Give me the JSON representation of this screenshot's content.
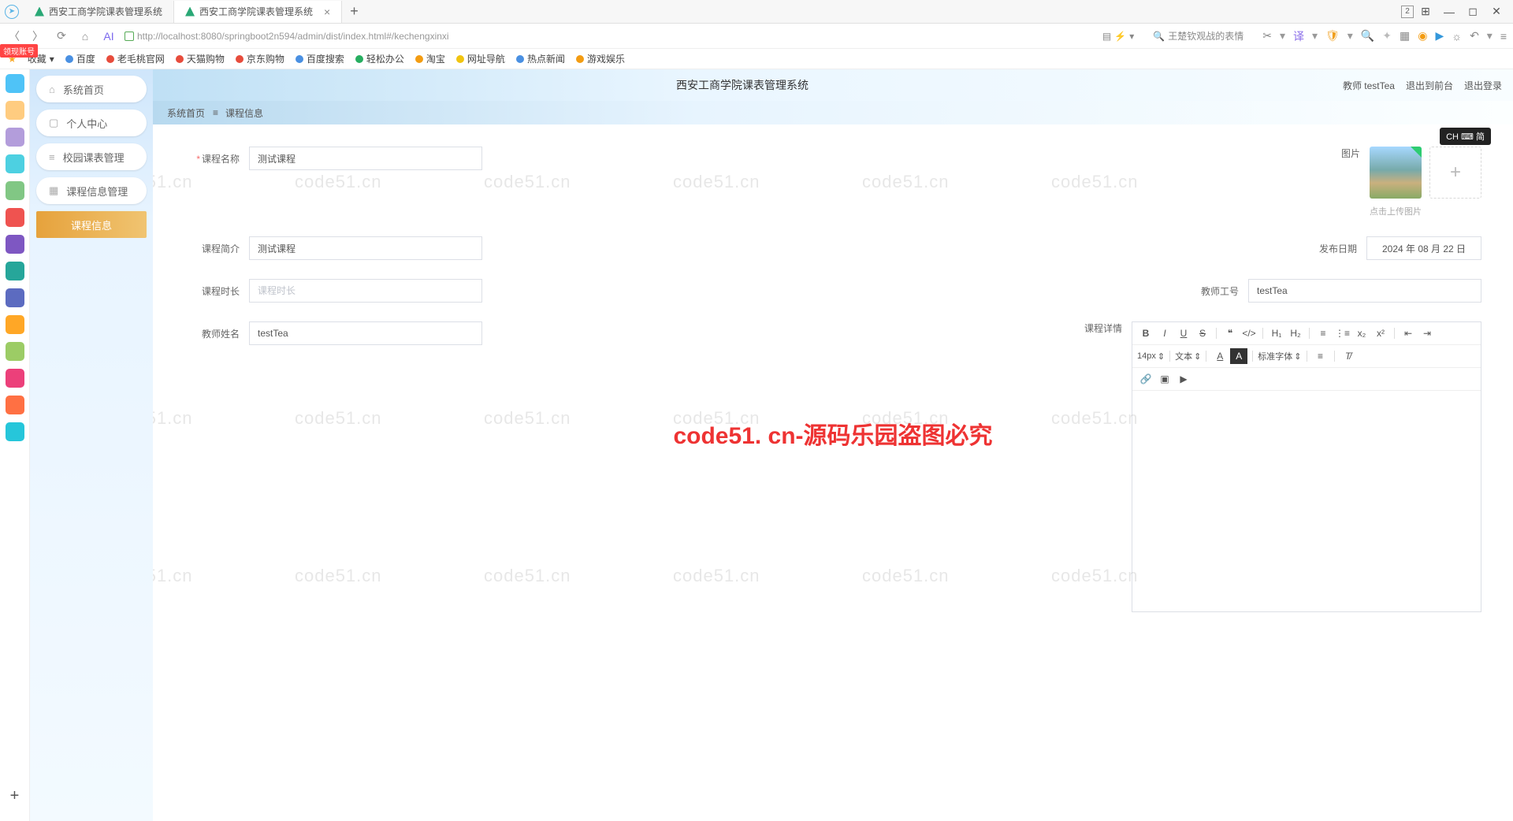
{
  "browser": {
    "tabs": [
      {
        "title": "西安工商学院课表管理系统",
        "active": false
      },
      {
        "title": "西安工商学院课表管理系统",
        "active": true
      }
    ],
    "tab_count_badge": "2",
    "url": "http://localhost:8080/springboot2n594/admin/dist/index.html#/kechengxinxi",
    "search_placeholder": "王楚钦观战的表情",
    "bookmarks": [
      "收藏",
      "百度",
      "老毛桃官网",
      "天猫购物",
      "京东购物",
      "百度搜索",
      "轻松办公",
      "淘宝",
      "网址导航",
      "热点新闻",
      "游戏娱乐"
    ],
    "bm_colors": [
      "#f9a825",
      "#4a90e2",
      "#e74c3c",
      "#e74c3c",
      "#e74c3c",
      "#4a90e2",
      "#27ae60",
      "#f39c12",
      "#f1c40f",
      "#4a90e2",
      "#f39c12"
    ],
    "tag360": "领现账号",
    "dock_colors": [
      "#4fc3f7",
      "#ffcc80",
      "#b39ddb",
      "#4dd0e1",
      "#81c784",
      "#ef5350",
      "#7e57c2",
      "#26a69a",
      "#5c6bc0",
      "#ffa726",
      "#9ccc65",
      "#ec407a",
      "#ff7043",
      "#26c6da",
      "#8bc34a"
    ]
  },
  "app": {
    "title": "西安工商学院课表管理系统",
    "user_label": "教师 testTea",
    "exit_front": "退出到前台",
    "logout": "退出登录",
    "nav": [
      {
        "icon": "⌂",
        "label": "系统首页"
      },
      {
        "icon": "▢",
        "label": "个人中心"
      },
      {
        "icon": "≡",
        "label": "校园课表管理"
      },
      {
        "icon": "▦",
        "label": "课程信息管理"
      }
    ],
    "nav_active": "课程信息",
    "breadcrumb": {
      "home": "系统首页",
      "sep": "≡",
      "cur": "课程信息"
    }
  },
  "form": {
    "course_name": {
      "label": "课程名称",
      "value": "测试课程",
      "required": true
    },
    "image": {
      "label": "图片",
      "hint": "点击上传图片"
    },
    "course_intro": {
      "label": "课程简介",
      "value": "测试课程"
    },
    "publish_date": {
      "label": "发布日期",
      "value": "2024 年 08 月 22 日"
    },
    "course_duration": {
      "label": "课程时长",
      "placeholder": "课程时长",
      "value": ""
    },
    "teacher_no": {
      "label": "教师工号",
      "value": "testTea"
    },
    "teacher_name": {
      "label": "教师姓名",
      "value": "testTea"
    },
    "course_detail": {
      "label": "课程详情"
    }
  },
  "editor": {
    "font_size": "14px",
    "text_menu": "文本",
    "font_family": "标准字体"
  },
  "watermark": "code51.cn",
  "big_watermark": "code51. cn-源码乐园盗图必究",
  "ime": "CH ⌨ 简"
}
